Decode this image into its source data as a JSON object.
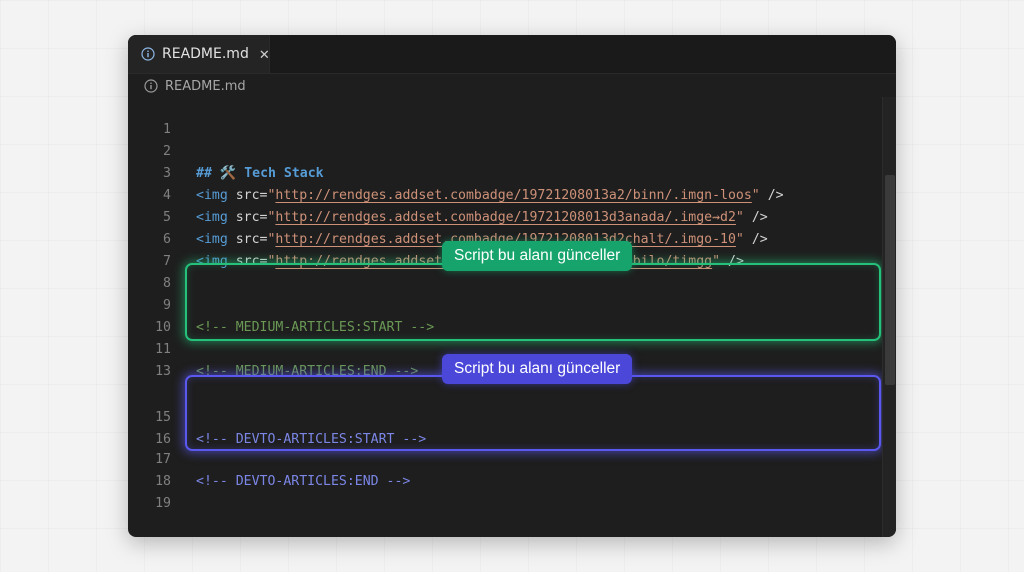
{
  "tab": {
    "label": "README.md",
    "close": "✕",
    "icon": "info-icon"
  },
  "breadcrumb": {
    "label": "README.md",
    "icon": "info-icon"
  },
  "lines": [
    {
      "num": "1"
    },
    {
      "num": "2",
      "prefix": "## ",
      "emoji": "🛠️",
      "title": " Tech Stack"
    },
    {
      "num": "3",
      "tag": "<img",
      "attr": " src=",
      "q1": "\"",
      "url": "http://rendges.addset.combadge/19721208013a2/binn/.imgn-loos",
      "q2": "\"",
      "end": " />"
    },
    {
      "num": "4",
      "tag": "<img",
      "attr": " src=",
      "q1": "\"",
      "url": "http://rendges.addset.combadge/19721208013d3anada/.imge⇝d2",
      "q2": "\"",
      "end": " />"
    },
    {
      "num": "5",
      "tag": "<img",
      "attr": " src=",
      "q1": "\"",
      "url": "http://rendges.addset.combadge/19721208013d2chalt/.imgo-10",
      "q2": "\"",
      "end": " />"
    },
    {
      "num": "6",
      "tag": "<img",
      "attr": " src=",
      "q1": "\"",
      "url": "http://rendges.addset.combadge/19721208013d3mbilo/timgg",
      "q2": "\"",
      "end": " />"
    },
    {
      "num": "7"
    },
    {
      "num": "8"
    },
    {
      "num": "9",
      "comment": "<!-- MEDIUM-ARTICLES:START -->"
    },
    {
      "num": "10"
    },
    {
      "num": "11",
      "comment": "<!-- MEDIUM-ARTICLES:END -->"
    },
    {
      "num": "13"
    },
    {
      "num": "15",
      "comment": "<!-- DEVTO-ARTICLES:START -->"
    },
    {
      "num": "16"
    },
    {
      "num": "17",
      "comment": "<!-- DEVTO-ARTICLES:END -->"
    },
    {
      "num": "18"
    },
    {
      "num": "19"
    }
  ],
  "callouts": {
    "medium": "Script bu alanı günceller",
    "devto": "Script bu alanı günceller"
  },
  "colors": {
    "medium_accent": "#25c07a",
    "devto_accent": "#5b58f0"
  }
}
